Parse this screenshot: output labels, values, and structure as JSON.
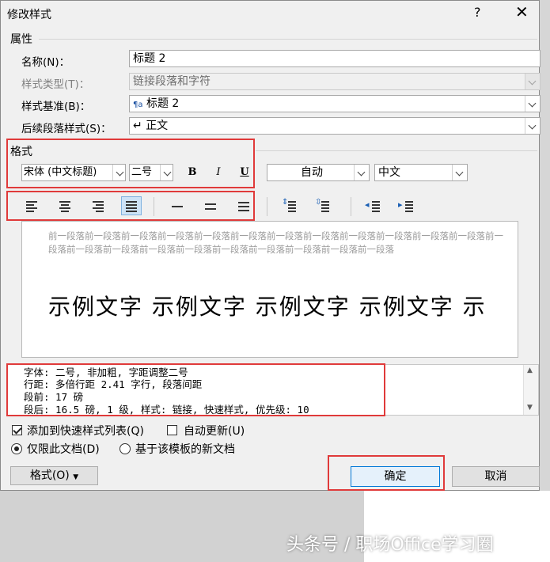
{
  "dialog": {
    "title": "修改样式",
    "help": "?",
    "close": "✕"
  },
  "properties": {
    "section": "属性",
    "name_label": "名称(N)：",
    "name_value": "标题 2",
    "type_label": "样式类型(T)：",
    "type_value": "链接段落和字符",
    "base_label": "样式基准(B)：",
    "base_value": "标题 2",
    "base_icon": "¶a",
    "next_label": "后续段落样式(S)：",
    "next_value": "正文",
    "next_icon": "↵"
  },
  "format": {
    "section": "格式",
    "font": "宋体 (中文标题)",
    "size": "二号",
    "bold": "B",
    "italic": "I",
    "underline": "U",
    "color": "自动",
    "language": "中文"
  },
  "preview": {
    "prev_text": "前一段落前一段落前一段落前一段落前一段落前一段落前一段落前一段落前一段落前一段落前一段落前一段落前一段落前一段落前一段落前一段落前一段落前一段落前一段落前一段落前一段落前一段落",
    "sample": "示例文字 示例文字 示例文字 示例文字 示"
  },
  "description": {
    "line1": "字体: 二号, 非加粗, 字距调整二号",
    "line2": "    行距: 多倍行距 2.41 字行, 段落间距",
    "line3": "    段前: 17 磅",
    "line4": "    段后: 16.5 磅, 1 级, 样式: 链接, 快速样式, 优先级: 10"
  },
  "options": {
    "add_quick": "添加到快速样式列表(Q)",
    "auto_update": "自动更新(U)",
    "only_doc": "仅限此文档(D)",
    "new_docs": "基于该模板的新文档"
  },
  "buttons": {
    "format": "格式(O)",
    "ok": "确定",
    "cancel": "取消"
  },
  "watermark": "头条号 / 职场Office学习圈",
  "colors": {
    "highlight_red": "#e03a3a",
    "primary_blue": "#0078d7"
  }
}
